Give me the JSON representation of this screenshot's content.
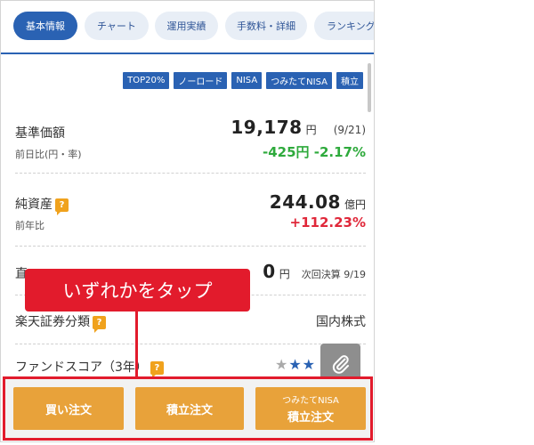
{
  "tabs": [
    {
      "label": "基本情報",
      "active": true
    },
    {
      "label": "チャート",
      "active": false
    },
    {
      "label": "運用実績",
      "active": false
    },
    {
      "label": "手数料・詳細",
      "active": false
    },
    {
      "label": "ランキング",
      "active": false
    }
  ],
  "tags": [
    "TOP20%",
    "ノーロード",
    "NISA",
    "つみたてNISA",
    "積立"
  ],
  "base_price": {
    "label": "基準価額",
    "value": "19,178",
    "unit": "円",
    "date": "(9/21)",
    "change_label": "前日比(円・率)",
    "change": "-425円 -2.17%"
  },
  "net_assets": {
    "label": "純資産",
    "value": "244.08",
    "unit": "億円",
    "change_label": "前年比",
    "change": "+112.23%"
  },
  "dividend": {
    "label_partial": "直",
    "value": "0",
    "unit": "円",
    "next": "次回決算 9/19"
  },
  "category": {
    "label": "楽天証券分類",
    "value": "国内株式"
  },
  "fund_score": {
    "label": "ファンドスコア（3年）",
    "stars_filled": 4,
    "stars_total": 5
  },
  "callout": "いずれかをタップ",
  "buttons": {
    "buy": "買い注文",
    "reserve": "積立注文",
    "tsumitate_small": "つみたてNISA",
    "tsumitate": "積立注文"
  },
  "colors": {
    "accent_blue": "#2a62b3",
    "order_orange": "#e8a23a",
    "highlight_red": "#e21b2c",
    "positive": "#e0283a",
    "negative": "#2eaa3c"
  },
  "icons": {
    "help": "question-icon",
    "clip": "paperclip-icon",
    "star": "star-icon"
  }
}
